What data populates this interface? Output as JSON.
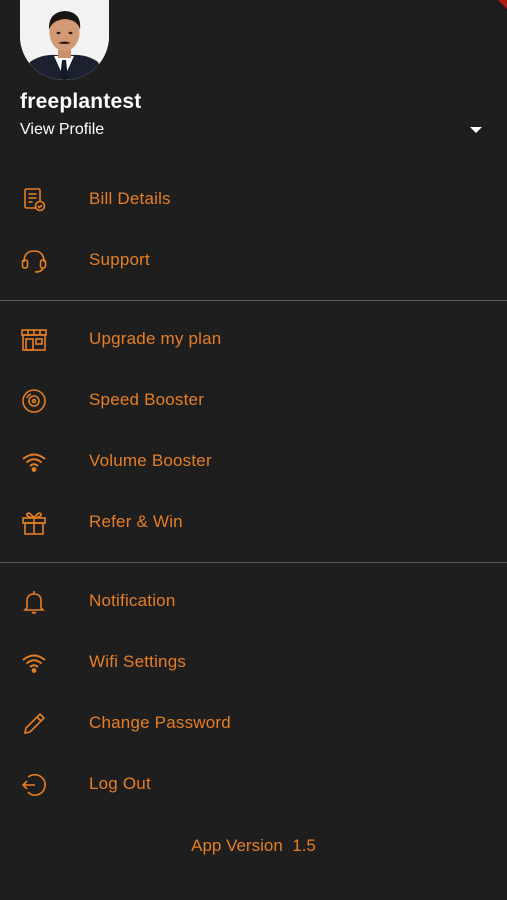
{
  "profile": {
    "username": "freeplantest",
    "view_profile_label": "View Profile"
  },
  "colors": {
    "background": "#1f1e1e",
    "accent": "#e57e25",
    "text_primary": "#ffffff",
    "divider": "#5a5a5a",
    "corner_accent": "#b11a17"
  },
  "menu": {
    "section1": [
      {
        "label": "Bill Details",
        "icon": "bill-icon"
      },
      {
        "label": "Support",
        "icon": "headset-icon"
      }
    ],
    "section2": [
      {
        "label": "Upgrade my plan",
        "icon": "store-icon"
      },
      {
        "label": "Speed Booster",
        "icon": "disc-icon"
      },
      {
        "label": "Volume Booster",
        "icon": "wifi-icon"
      },
      {
        "label": "Refer & Win",
        "icon": "gift-icon"
      }
    ],
    "section3": [
      {
        "label": "Notification",
        "icon": "bell-icon"
      },
      {
        "label": "Wifi Settings",
        "icon": "wifi-icon"
      },
      {
        "label": "Change Password",
        "icon": "pencil-icon"
      },
      {
        "label": "Log Out",
        "icon": "logout-icon"
      }
    ]
  },
  "footer": {
    "app_version_label": "App Version",
    "app_version_number": "1.5"
  }
}
